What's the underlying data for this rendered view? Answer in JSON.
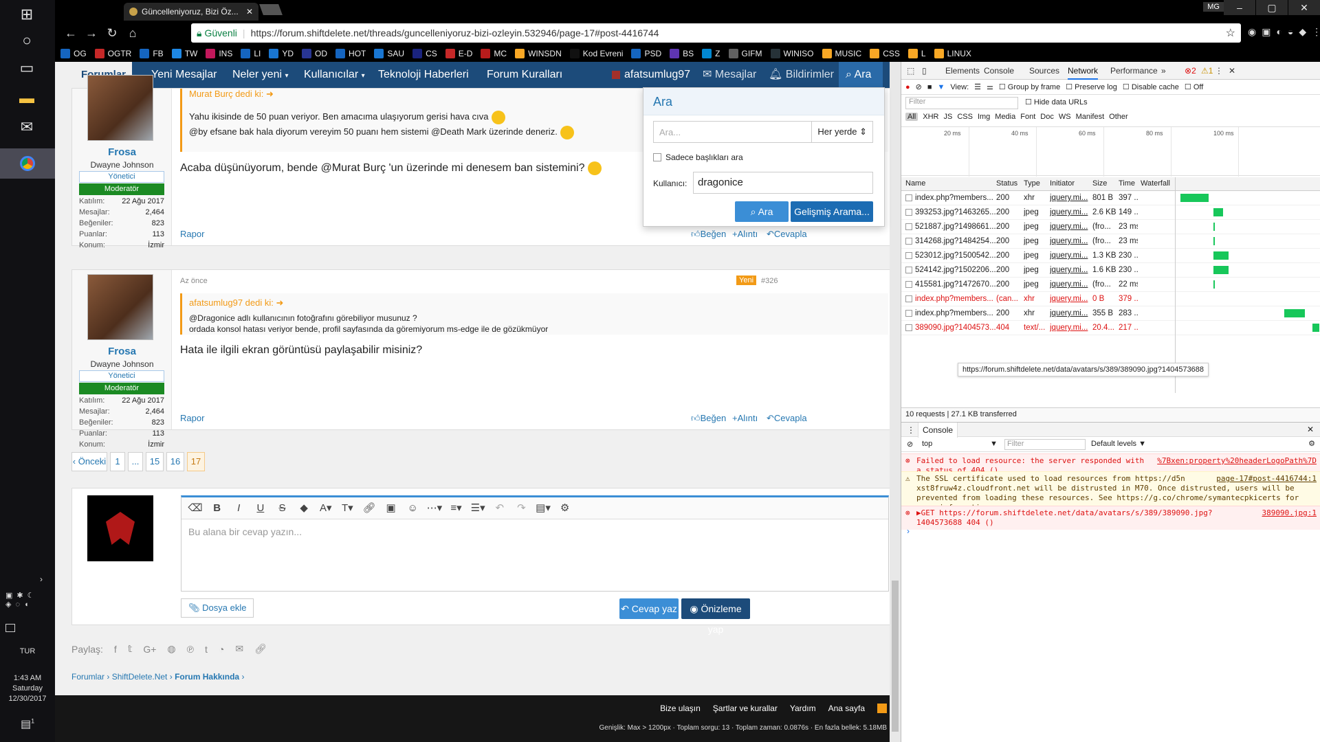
{
  "browser": {
    "tab_title": "Güncelleniyoruz, Bizi Öz...",
    "secure_label": "Güvenli",
    "url": "https://forum.shiftdelete.net/threads/guncelleniyoruz-bizi-ozleyin.532946/page-17#post-4416744",
    "profile": "MG",
    "bookmarks": [
      "OG",
      "OGTR",
      "FB",
      "TW",
      "INS",
      "LI",
      "YD",
      "OD",
      "HOT",
      "SAU",
      "CS",
      "E-D",
      "MC",
      "WINSDN",
      "Kod Evreni",
      "PSD",
      "BS",
      "Z",
      "GIFM",
      "WINISO",
      "MUSIC",
      "CSS",
      "L",
      "LINUX"
    ]
  },
  "taskbar": {
    "lang": "TUR",
    "time": "1:43 AM",
    "day": "Saturday",
    "date": "12/30/2017",
    "notif": "1"
  },
  "forum": {
    "nav": [
      "Forumlar",
      "Yeni Mesajlar",
      "Neler yeni",
      "Kullanıcılar",
      "Teknoloji Haberleri",
      "Forum Kuralları"
    ],
    "user": "afatsumlug97",
    "messages": "Mesajlar",
    "notifications": "Bildirimler",
    "search": "Ara"
  },
  "search_popup": {
    "title": "Ara",
    "placeholder": "Ara...",
    "scope": "Her yerde",
    "titles_only": "Sadece başlıkları ara",
    "user_label": "Kullanıcı:",
    "user_value": "dragonice",
    "search_button": "Ara",
    "advanced_button": "Gelişmiş Arama..."
  },
  "posts": [
    {
      "username": "Frosa",
      "realname": "Dwayne Johnson",
      "badge": "Yönetici",
      "role": "Moderatör",
      "stats": [
        [
          "Katılım:",
          "22 Ağu 2017"
        ],
        [
          "Mesajlar:",
          "2,464"
        ],
        [
          "Beğeniler:",
          "823"
        ],
        [
          "Puanlar:",
          "113"
        ],
        [
          "Konum:",
          "İzmir"
        ]
      ],
      "quote_author": "Murat Burç dedi ki:",
      "quote_lines": [
        "Yahu ikisinde de 50 puan veriyor. Ben amacıma ulaşıyorum gerisi hava cıva",
        "@by efsane bak hala diyorum vereyim 50 puanı hem sistemi @Death Mark üzerinde deneriz."
      ],
      "message": "Acaba düşünüyorum, bende @Murat Burç 'un üzerinde mi denesem ban sistemini?",
      "report": "Rapor",
      "like": "Beğen",
      "quote": "Alıntı",
      "reply": "Cevapla"
    },
    {
      "username": "Frosa",
      "realname": "Dwayne Johnson",
      "badge": "Yönetici",
      "role": "Moderatör",
      "stats": [
        [
          "Katılım:",
          "22 Ağu 2017"
        ],
        [
          "Mesajlar:",
          "2,464"
        ],
        [
          "Beğeniler:",
          "823"
        ],
        [
          "Puanlar:",
          "113"
        ],
        [
          "Konum:",
          "İzmir"
        ]
      ],
      "time": "Az önce",
      "new_badge": "Yeni",
      "post_num": "#326",
      "quote_author": "afatsumlug97 dedi ki:",
      "quote_lines": [
        "@Dragonice adlı kullanıcının fotoğrafını görebiliyor musunuz ?",
        "ordada konsol hatası veriyor bende, profil sayfasında da göremiyorum ms-edge ile de gözükmüyor"
      ],
      "message": "Hata ile ilgili ekran görüntüsü paylaşabilir misiniz?",
      "report": "Rapor",
      "like": "Beğen",
      "quote": "Alıntı",
      "reply": "Cevapla"
    }
  ],
  "pagination": [
    "‹ Önceki",
    "1",
    "...",
    "15",
    "16",
    "17"
  ],
  "editor": {
    "placeholder": "Bu alana bir cevap yazın...",
    "attach": "Dosya ekle",
    "submit": "Cevap yaz",
    "preview": "Önizleme yap"
  },
  "share_label": "Paylaş:",
  "breadcrumb": [
    "Forumlar",
    "ShiftDelete.Net",
    "Forum Hakkında"
  ],
  "footer": {
    "links": [
      "Bize ulaşın",
      "Şartlar ve kurallar",
      "Yardım",
      "Ana sayfa"
    ],
    "stats": "Genişlik: Max > 1200px · Toplam sorgu: 13 · Toplam zaman: 0.0876s · En fazla bellek: 5.18MB"
  },
  "devtools": {
    "tabs": [
      "Elements",
      "Console",
      "Sources",
      "Network",
      "Performance"
    ],
    "errors": "2",
    "warnings": "1",
    "view_label": "View:",
    "group_by_frame": "Group by frame",
    "preserve_log": "Preserve log",
    "disable_cache": "Disable cache",
    "offline": "Off",
    "filter_placeholder": "Filter",
    "hide_data_urls": "Hide data URLs",
    "filter_types": [
      "All",
      "XHR",
      "JS",
      "CSS",
      "Img",
      "Media",
      "Font",
      "Doc",
      "WS",
      "Manifest",
      "Other"
    ],
    "timeline_ticks": [
      "20 ms",
      "40 ms",
      "60 ms",
      "80 ms",
      "100 ms"
    ],
    "columns": [
      "Name",
      "Status",
      "Type",
      "Initiator",
      "Size",
      "Time",
      "Waterfall"
    ],
    "requests": [
      {
        "name": "index.php?members...",
        "status": "200",
        "type": "xhr",
        "init": "jquery.mi...",
        "size": "801 B",
        "time": "397 ...",
        "error": false,
        "wf_start": 0.02,
        "wf_len": 0.2
      },
      {
        "name": "393253.jpg?1463265...",
        "status": "200",
        "type": "jpeg",
        "init": "jquery.mi...",
        "size": "2.6 KB",
        "time": "149 ...",
        "error": false,
        "wf_start": 0.25,
        "wf_len": 0.07
      },
      {
        "name": "521887.jpg?1498661...",
        "status": "200",
        "type": "jpeg",
        "init": "jquery.mi...",
        "size": "(fro...",
        "time": "23 ms",
        "error": false,
        "wf_start": 0.25,
        "wf_len": 0.01
      },
      {
        "name": "314268.jpg?1484254...",
        "status": "200",
        "type": "jpeg",
        "init": "jquery.mi...",
        "size": "(fro...",
        "time": "23 ms",
        "error": false,
        "wf_start": 0.25,
        "wf_len": 0.01
      },
      {
        "name": "523012.jpg?1500542...",
        "status": "200",
        "type": "jpeg",
        "init": "jquery.mi...",
        "size": "1.3 KB",
        "time": "230 ...",
        "error": false,
        "wf_start": 0.25,
        "wf_len": 0.11
      },
      {
        "name": "524142.jpg?1502206...",
        "status": "200",
        "type": "jpeg",
        "init": "jquery.mi...",
        "size": "1.6 KB",
        "time": "230 ...",
        "error": false,
        "wf_start": 0.25,
        "wf_len": 0.11
      },
      {
        "name": "415581.jpg?1472670...",
        "status": "200",
        "type": "jpeg",
        "init": "jquery.mi...",
        "size": "(fro...",
        "time": "22 ms",
        "error": false,
        "wf_start": 0.25,
        "wf_len": 0.01
      },
      {
        "name": "index.php?members...",
        "status": "(can...",
        "type": "xhr",
        "init": "jquery.mi...",
        "size": "0 B",
        "time": "379 ...",
        "error": true,
        "wf_start": 0,
        "wf_len": 0
      },
      {
        "name": "index.php?members...",
        "status": "200",
        "type": "xhr",
        "init": "jquery.mi...",
        "size": "355 B",
        "time": "283 ...",
        "error": false,
        "wf_start": 0.75,
        "wf_len": 0.15
      },
      {
        "name": "389090.jpg?1404573...",
        "status": "404",
        "type": "text/...",
        "init": "jquery.mi...",
        "size": "20.4...",
        "time": "217 ...",
        "error": true,
        "wf_start": 0.95,
        "wf_len": 0.05
      }
    ],
    "tooltip": "https://forum.shiftdelete.net/data/avatars/s/389/389090.jpg?1404573688",
    "summary": "10 requests  |  27.1 KB transferred",
    "console_tab": "Console",
    "context": "top",
    "console_filter": "Filter",
    "levels": "Default levels",
    "console": [
      {
        "level": "error",
        "text": "Failed to load resource: the server responded with a status of 404 ()",
        "link": "%7Bxen:property%20headerLogoPath%7D"
      },
      {
        "level": "warning",
        "text": "The SSL certificate used to load resources from https://d5n xst8fruw4z.cloudfront.net will be distrusted in M70. Once distrusted, users will be prevented from loading these resources. See https://g.co/chrome/symantecpkicerts for more information.",
        "link": "page-17#post-4416744:1"
      },
      {
        "level": "error",
        "text": "▶GET https://forum.shiftdelete.net/data/avatars/s/389/389090.jpg?1404573688 404 ()",
        "link": "389090.jpg:1"
      }
    ]
  },
  "colors": {
    "nav_bg": "#1c4b7a",
    "accent": "#2577b1",
    "quote_orange": "#f29a16",
    "moderator_green": "#1b8a23",
    "waterfall_green": "#17c75a",
    "error_red": "#d11"
  }
}
